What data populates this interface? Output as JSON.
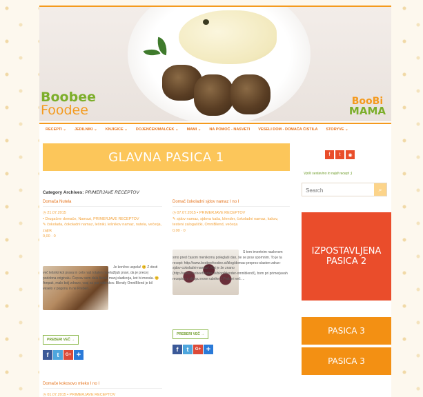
{
  "header": {
    "logo_left_line1": "Boobee",
    "logo_left_line2": "Foodee",
    "logo_right_line1": "BooBi",
    "logo_right_line2": "MAMA"
  },
  "nav": {
    "items": [
      "RECEPTI ⌄",
      "JEDILNIKI ⌄",
      "KNJIGICE ⌄",
      "DOJENČEK/MALČEK ⌄",
      "MAMI ⌄",
      "NA POMOČ - NASVETI",
      "VESELI DOM - DOMAČA ČISTILA",
      "STORYVE ⌄"
    ]
  },
  "banner": {
    "text": "GLAVNA PASICA 1"
  },
  "archive": {
    "label": "Category Archives:",
    "category": "PRIMERJAVE RECEPTOV"
  },
  "posts": [
    {
      "title": "Domača Nutela",
      "date": "21.07.2015",
      "category": "Drugačne domače, Namazi, PRIMERJAVE RECEPTOV",
      "tags": "čokolada, čokoladni namaz, lešniki, lešnikov namaz, nutela, večerja, zajtrk",
      "stats": "0,00 · 0",
      "excerpt": "Je končno uspela! 😊 Z dosti več lešniki kot prava in celo naš totalen nutelažljub pravi, da je precej podobna originalu. Čeprav sem dala fizouli manj sladkorja, kot bi morala. 😊 Ampak, malo bolj zdravo, vsaj za par odtenkov. Blendy OmniBlend je bil veselo v pogonu in ne Preberi...",
      "more": "PREBERI VEČ →"
    },
    {
      "title": "Domač čokoladni sjdov namaz I no I",
      "date": "07.07.2015",
      "category": "PRIMERJAVE RECEPTOV",
      "tags": "sjdov namaz, sjdova kaša, blender, čokoladni namaz, kakav, testeni zalogaščki, OmniBlend, večerja",
      "stats": "0,00 · 0",
      "excerpt": "S tem imentnim naslovom smo pred časom menikomu poleglaši dan, še se prav spomnim. To je ta recept: http://www.boobeefoodee.si/blog/domac-prepros-slasten-zdrav-sjdov-cokoladni-namaz/. Kot je že znano (http://www.boobeefoodee.si/blog/blender-omniblend/), bom pri primerjavah receptov v sklopu nove rubrike 1 Preberi več ...",
      "more": "PREBERI VEČ →"
    },
    {
      "title": "Domače kokosovo mleko I no I",
      "date": "01.07.2015",
      "category": "PRIMERJAVE RECEPTOV"
    }
  ],
  "sidebar": {
    "search_label": "Vpiši sestavino in najdi recept :)",
    "search_placeholder": "Search",
    "promo1": "IZPOSTAVLJENA PASICA 2",
    "promo2": "PASICA 3",
    "promo3": "PASICA 3"
  },
  "colors": {
    "accent": "#e5731c",
    "banner": "#fcc65a",
    "promo_red": "#ea4d2b",
    "promo_orange": "#f39013",
    "green": "#7cae2a"
  }
}
